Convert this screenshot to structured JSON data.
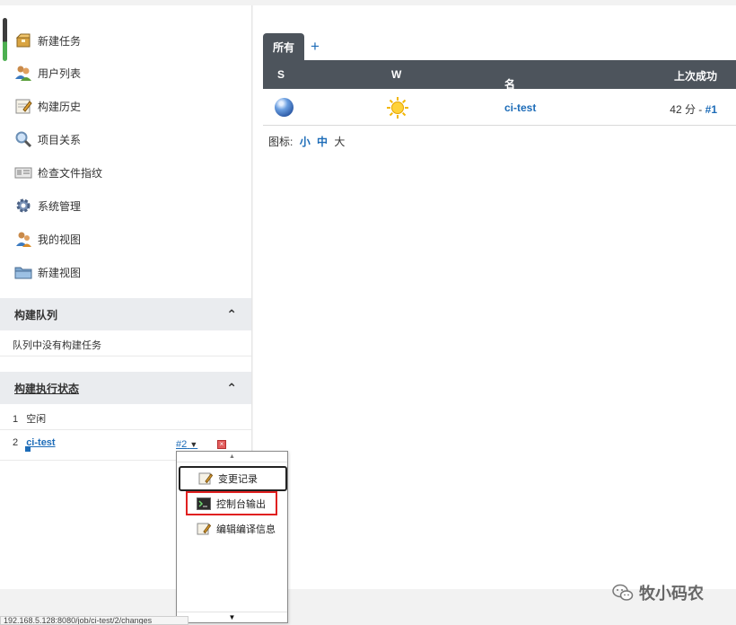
{
  "sidebar": {
    "tasks": [
      {
        "label": "新建任务",
        "icon": "package-icon"
      },
      {
        "label": "用户列表",
        "icon": "users-icon"
      },
      {
        "label": "构建历史",
        "icon": "notepad-icon"
      },
      {
        "label": "项目关系",
        "icon": "magnifier-icon"
      },
      {
        "label": "检查文件指纹",
        "icon": "id-card-icon"
      },
      {
        "label": "系统管理",
        "icon": "gear-icon"
      },
      {
        "label": "我的视图",
        "icon": "user-icon"
      },
      {
        "label": "新建视图",
        "icon": "folder-icon"
      }
    ],
    "queue": {
      "title": "构建队列",
      "empty_text": "队列中没有构建任务"
    },
    "executors": {
      "title": "构建执行状态",
      "rows": [
        {
          "num": "1",
          "text": "空闲"
        },
        {
          "num": "2",
          "job": "ci-test",
          "build": "#2"
        }
      ]
    }
  },
  "main": {
    "tabs": {
      "active": "所有",
      "add": "+"
    },
    "table": {
      "headers": {
        "s": "S",
        "w": "W",
        "name": "名称",
        "name_sort": "↓",
        "last_success": "上次成功"
      },
      "rows": [
        {
          "job": "ci-test",
          "last_success_time": "42 分 -",
          "last_success_build": "#1"
        }
      ]
    },
    "icon_size": {
      "label": "图标:",
      "small": "小",
      "medium": "中",
      "large": "大"
    }
  },
  "dropdown": {
    "items": [
      {
        "label": "变更记录"
      },
      {
        "label": "控制台输出"
      },
      {
        "label": "编辑编译信息"
      }
    ]
  },
  "status_bar": {
    "url": "192.168.5.128:8080/job/ci-test/2/changes"
  },
  "watermark": {
    "text": "牧小码农"
  },
  "colors": {
    "accent": "#1d6cb8",
    "header_bg": "#4d545c",
    "panel_bg": "#eaecef",
    "highlight": "#e02020"
  }
}
